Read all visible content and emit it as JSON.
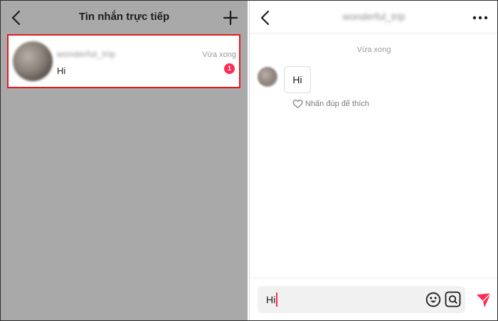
{
  "left": {
    "title": "Tin nhắn trực tiếp",
    "conversation": {
      "name": "wonderful_trip",
      "preview": "Hi",
      "time": "Vừa xong",
      "unread_count": "1"
    }
  },
  "right": {
    "contact_name": "wonderful_trip",
    "timestamp": "Vừa xong",
    "messages": [
      {
        "text": "Hi"
      }
    ],
    "like_hint": "Nhấn đúp để thích",
    "input": {
      "value": "Hi"
    }
  },
  "colors": {
    "highlight_border": "#e11b22",
    "accent": "#fe2c55",
    "dim_overlay": "#a9a9a9"
  },
  "icons": [
    "back-icon",
    "plus-icon",
    "more-icon",
    "heart-icon",
    "emoji-icon",
    "mention-icon",
    "send-icon"
  ]
}
